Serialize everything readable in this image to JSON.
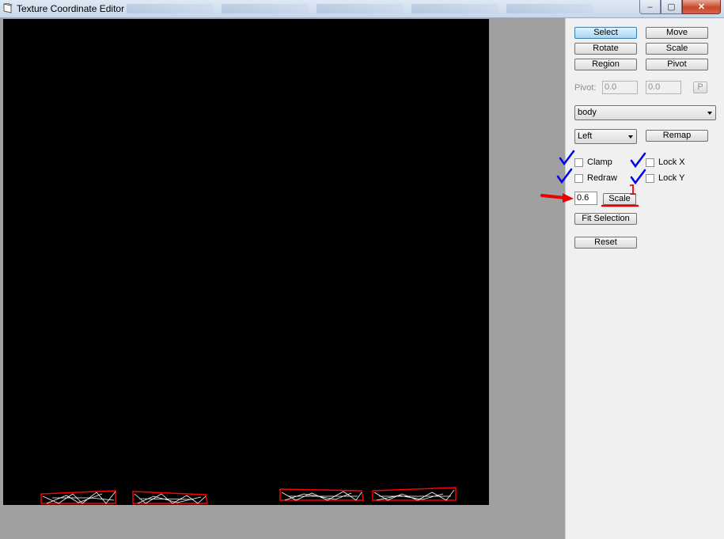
{
  "window": {
    "title": "Texture Coordinate Editor",
    "minimize_glyph": "–",
    "maximize_glyph": "▢",
    "close_glyph": "✕"
  },
  "toolbar": {
    "select_label": "Select",
    "move_label": "Move",
    "rotate_label": "Rotate",
    "scale_label": "Scale",
    "region_label": "Region",
    "pivot_label": "Pivot"
  },
  "pivot": {
    "label": "Pivot:",
    "x": "0.0",
    "y": "0.0",
    "p_label": "P"
  },
  "mesh_select": {
    "value": "body"
  },
  "side_select": {
    "value": "Left"
  },
  "remap_label": "Remap",
  "options": {
    "clamp_label": "Clamp",
    "lock_x_label": "Lock X",
    "redraw_label": "Redraw",
    "lock_y_label": "Lock Y"
  },
  "scale_value": "0.6",
  "scale_apply_label": "Scale",
  "annotation_number": "1",
  "fit_selection_label": "Fit Selection",
  "reset_label": "Reset",
  "colors": {
    "canvas": "#000000",
    "uv_edges": "#ff0000",
    "uv_inner": "#ffffff",
    "annotation_check": "#0000ee",
    "annotation_red": "#ee0000",
    "active_button": "#a9d6f2"
  }
}
